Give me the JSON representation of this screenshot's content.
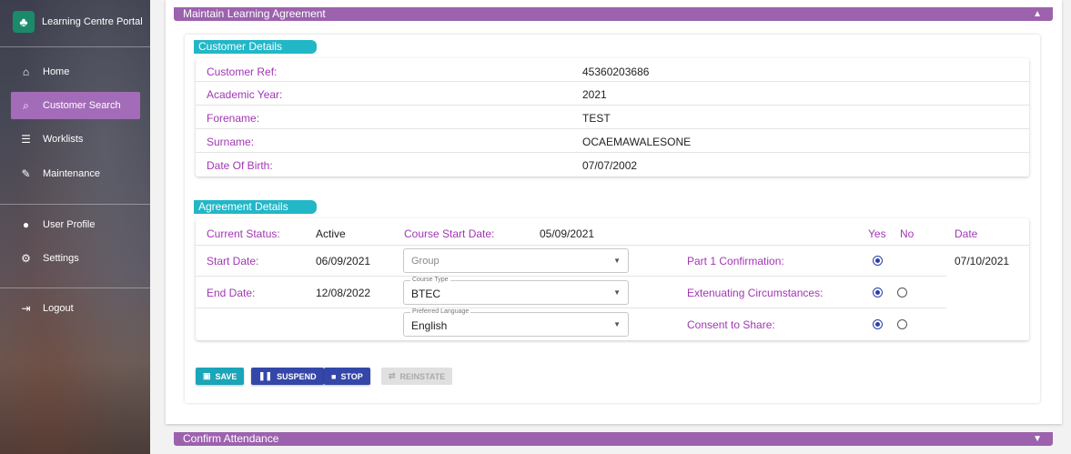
{
  "sidebar": {
    "brand": "Learning Centre Portal",
    "items": [
      {
        "label": "Home"
      },
      {
        "label": "Customer Search"
      },
      {
        "label": "Worklists"
      },
      {
        "label": "Maintenance"
      },
      {
        "label": "User Profile"
      },
      {
        "label": "Settings"
      },
      {
        "label": "Logout"
      }
    ]
  },
  "panel": {
    "title": "Maintain Learning Agreement"
  },
  "customer": {
    "section_title": "Customer Details",
    "rows": [
      {
        "label": "Customer Ref:",
        "value": "45360203686"
      },
      {
        "label": "Academic Year:",
        "value": "2021"
      },
      {
        "label": "Forename:",
        "value": "TEST"
      },
      {
        "label": "Surname:",
        "value": "OCAEMAWALESONE"
      },
      {
        "label": "Date Of Birth:",
        "value": "07/07/2002"
      }
    ]
  },
  "agreement": {
    "section_title": "Agreement Details",
    "current_status_label": "Current Status:",
    "current_status_value": "Active",
    "course_start_label": "Course Start Date:",
    "course_start_value": "05/09/2021",
    "start_date_label": "Start Date:",
    "start_date_value": "06/09/2021",
    "end_date_label": "End Date:",
    "end_date_value": "12/08/2022",
    "group_placeholder": "Group",
    "course_type_caption": "Course Type",
    "course_type_value": "BTEC",
    "language_caption": "Preferred Language",
    "language_value": "English",
    "col_yes": "Yes",
    "col_no": "No",
    "col_date": "Date",
    "confirmations": [
      {
        "label": "Part 1 Confirmation:",
        "yes": true,
        "date": "07/10/2021"
      },
      {
        "label": "Extenuating Circumstances:",
        "yes": true,
        "date": ""
      },
      {
        "label": "Consent to Share:",
        "yes": true,
        "date": ""
      }
    ]
  },
  "buttons": {
    "save": "SAVE",
    "suspend": "SUSPEND",
    "stop": "STOP",
    "reinstate": "REINSTATE"
  },
  "footer_panel": {
    "title": "Confirm Attendance"
  },
  "colors": {
    "accent": "#9c62ad",
    "section": "#22b7c7",
    "label": "#a236b5",
    "primary_btn": "#3447a9"
  }
}
